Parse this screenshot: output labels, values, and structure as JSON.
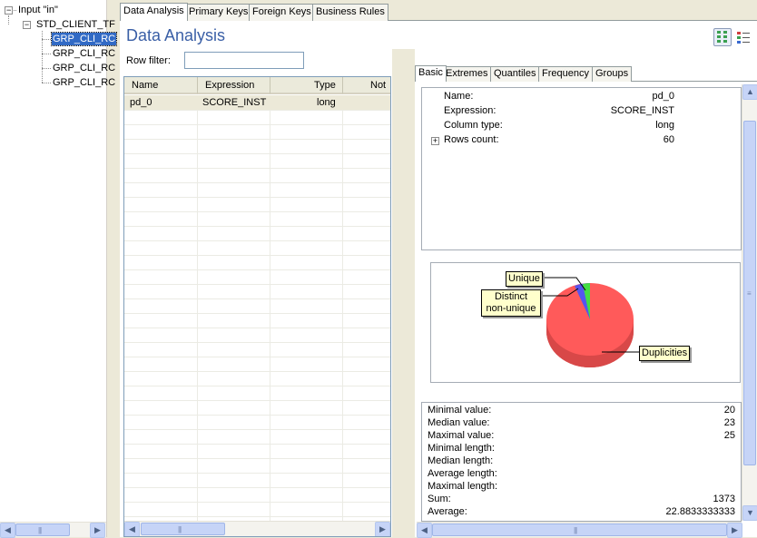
{
  "tree": {
    "root_label": "Input \"in\"",
    "child_label": "STD_CLIENT_TF",
    "items": [
      "GRP_CLI_RC",
      "GRP_CLI_RC",
      "GRP_CLI_RC",
      "GRP_CLI_RC"
    ]
  },
  "tabs": [
    "Data Analysis",
    "Primary Keys",
    "Foreign Keys",
    "Business Rules"
  ],
  "title": "Data Analysis",
  "row_filter": {
    "label": "Row filter:",
    "value": ""
  },
  "grid": {
    "columns": [
      "Name",
      "Expression",
      "Type",
      "Not"
    ],
    "rows": [
      {
        "name": "pd_0",
        "expression": "SCORE_INST",
        "type": "long"
      }
    ]
  },
  "subtabs": [
    "Basic",
    "Extremes",
    "Quantiles",
    "Frequency",
    "Groups"
  ],
  "basic": [
    {
      "label": "Name:",
      "value": "pd_0"
    },
    {
      "label": "Expression:",
      "value": "SCORE_INST"
    },
    {
      "label": "Column type:",
      "value": "long"
    },
    {
      "label": "Rows count:",
      "value": "60"
    }
  ],
  "pie": {
    "labels": {
      "unique": "Unique",
      "distinct_non_unique": "Distinct non-unique",
      "duplicities": "Duplicities"
    },
    "colors": {
      "unique": "#44dd44",
      "distinct": "#5555ee",
      "duplicities": "#ff5a5a"
    }
  },
  "stats": [
    {
      "label": "Minimal value:",
      "value": "20"
    },
    {
      "label": "Median value:",
      "value": "23"
    },
    {
      "label": "Maximal value:",
      "value": "25"
    },
    {
      "label": "Minimal length:",
      "value": ""
    },
    {
      "label": "Median length:",
      "value": ""
    },
    {
      "label": "Average length:",
      "value": ""
    },
    {
      "label": "Maximal length:",
      "value": ""
    },
    {
      "label": "Sum:",
      "value": "1373"
    },
    {
      "label": "Average:",
      "value": "22.8833333333"
    }
  ]
}
